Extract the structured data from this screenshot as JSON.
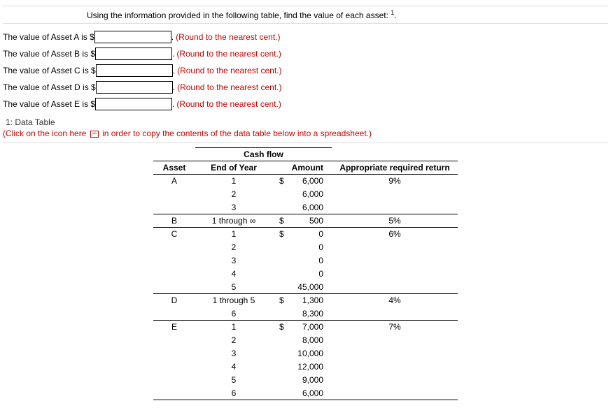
{
  "instruction": "Using the information provided in the following table, find the value of each asset: ",
  "instruction_footnote": "1",
  "round_hint": "(Round to the nearest cent.)",
  "prompts": [
    "The value of Asset A is $",
    "The value of Asset B is $",
    "The value of Asset C is $",
    "The value of Asset D is $",
    "The value of Asset E is $"
  ],
  "section_label": "1: Data Table",
  "copy_hint_before": "(Click on the icon here ",
  "copy_hint_after": " in order to copy the contents of the data table below into a spreadsheet.)",
  "columns": {
    "group_header": "Cash flow",
    "asset": "Asset",
    "end_of_year": "End of Year",
    "amount": "Amount",
    "return": "Appropriate required return"
  },
  "chart_data": {
    "type": "table",
    "columns": [
      "Asset",
      "End of Year",
      "Amount",
      "Appropriate required return"
    ],
    "rows": [
      {
        "asset": "A",
        "end_of_year": "1",
        "amount_symbol": "$",
        "amount": "6,000",
        "return": "9%",
        "lead": true
      },
      {
        "asset": "",
        "end_of_year": "2",
        "amount_symbol": "",
        "amount": "6,000",
        "return": ""
      },
      {
        "asset": "",
        "end_of_year": "3",
        "amount_symbol": "",
        "amount": "6,000",
        "return": ""
      },
      {
        "asset": "B",
        "end_of_year": "1 through ∞",
        "amount_symbol": "$",
        "amount": "500",
        "return": "5%",
        "lead": true
      },
      {
        "asset": "C",
        "end_of_year": "1",
        "amount_symbol": "$",
        "amount": "0",
        "return": "6%",
        "lead": true
      },
      {
        "asset": "",
        "end_of_year": "2",
        "amount_symbol": "",
        "amount": "0",
        "return": ""
      },
      {
        "asset": "",
        "end_of_year": "3",
        "amount_symbol": "",
        "amount": "0",
        "return": ""
      },
      {
        "asset": "",
        "end_of_year": "4",
        "amount_symbol": "",
        "amount": "0",
        "return": ""
      },
      {
        "asset": "",
        "end_of_year": "5",
        "amount_symbol": "",
        "amount": "45,000",
        "return": ""
      },
      {
        "asset": "D",
        "end_of_year": "1 through 5",
        "amount_symbol": "$",
        "amount": "1,300",
        "return": "4%",
        "lead": true
      },
      {
        "asset": "",
        "end_of_year": "6",
        "amount_symbol": "",
        "amount": "8,300",
        "return": ""
      },
      {
        "asset": "E",
        "end_of_year": "1",
        "amount_symbol": "$",
        "amount": "7,000",
        "return": "7%",
        "lead": true
      },
      {
        "asset": "",
        "end_of_year": "2",
        "amount_symbol": "",
        "amount": "8,000",
        "return": ""
      },
      {
        "asset": "",
        "end_of_year": "3",
        "amount_symbol": "",
        "amount": "10,000",
        "return": ""
      },
      {
        "asset": "",
        "end_of_year": "4",
        "amount_symbol": "",
        "amount": "12,000",
        "return": ""
      },
      {
        "asset": "",
        "end_of_year": "5",
        "amount_symbol": "",
        "amount": "9,000",
        "return": ""
      },
      {
        "asset": "",
        "end_of_year": "6",
        "amount_symbol": "",
        "amount": "6,000",
        "return": ""
      }
    ]
  }
}
